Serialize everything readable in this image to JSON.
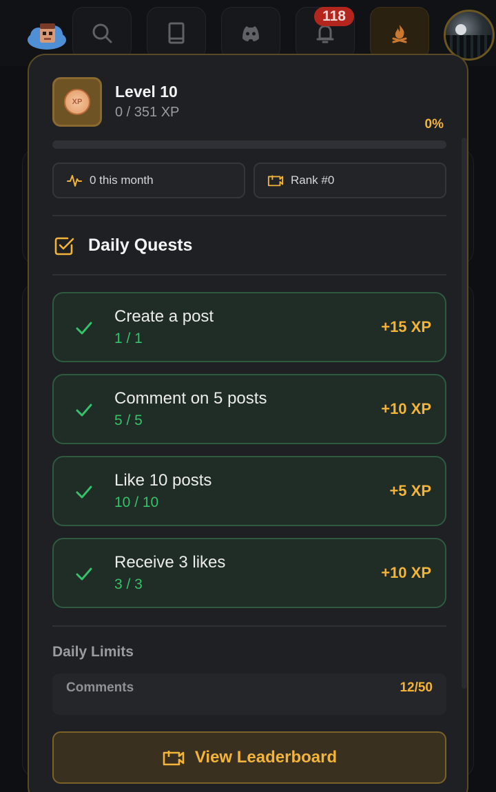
{
  "nav": {
    "items": [
      {
        "name": "search",
        "icon": "search-icon"
      },
      {
        "name": "book",
        "icon": "book-icon"
      },
      {
        "name": "discord",
        "icon": "discord-icon"
      },
      {
        "name": "notifications",
        "icon": "bell-icon"
      },
      {
        "name": "quests",
        "icon": "campfire-icon"
      }
    ],
    "notification_count": "118"
  },
  "level": {
    "title": "Level 10",
    "xp_text": "0 / 351 XP",
    "percent_label": "0%",
    "progress_fraction": 0
  },
  "stats": {
    "month": "0 this month",
    "rank": "Rank #0"
  },
  "daily_quests": {
    "title": "Daily Quests",
    "items": [
      {
        "name": "Create a post",
        "progress": "1 / 1",
        "reward": "+15 XP"
      },
      {
        "name": "Comment on 5 posts",
        "progress": "5 / 5",
        "reward": "+10 XP"
      },
      {
        "name": "Like 10 posts",
        "progress": "10 / 10",
        "reward": "+5 XP"
      },
      {
        "name": "Receive 3 likes",
        "progress": "3 / 3",
        "reward": "+10 XP"
      }
    ]
  },
  "daily_limits": {
    "title": "Daily Limits",
    "items": [
      {
        "label": "Comments",
        "value": "12/50"
      }
    ]
  },
  "leaderboard_button": "View Leaderboard",
  "colors": {
    "accent": "#f3b43a",
    "success": "#35c26a",
    "panel": "#1f2024",
    "badge": "#b3261e"
  }
}
